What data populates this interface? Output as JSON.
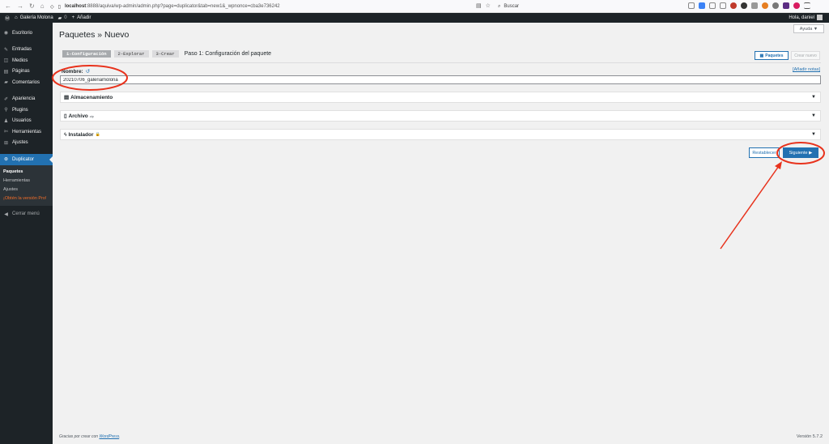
{
  "browser": {
    "url_host": "localhost",
    "url_rest": ":8888/aquiva/wp-admin/admin.php?page=duplicator&tab=new1&_wpnonce=cba3e736242",
    "search_placeholder": "Buscar"
  },
  "adminbar": {
    "site_name": "Galería Molona",
    "comments_count": "0",
    "add_label": "Añadir",
    "howdy": "Hola, daniel"
  },
  "sidebar": {
    "items": [
      {
        "label": "Escritorio",
        "icon": "dashboard-icon"
      },
      {
        "label": "Entradas",
        "icon": "pin-icon"
      },
      {
        "label": "Medios",
        "icon": "media-icon"
      },
      {
        "label": "Páginas",
        "icon": "pages-icon"
      },
      {
        "label": "Comentarios",
        "icon": "comments-icon"
      },
      {
        "label": "Apariencia",
        "icon": "brush-icon"
      },
      {
        "label": "Plugins",
        "icon": "plugin-icon"
      },
      {
        "label": "Usuarios",
        "icon": "users-icon"
      },
      {
        "label": "Herramientas",
        "icon": "wrench-icon"
      },
      {
        "label": "Ajustes",
        "icon": "settings-icon"
      },
      {
        "label": "Duplicator",
        "icon": "duplicator-icon"
      }
    ],
    "submenu": [
      "Paquetes",
      "Herramientas",
      "Ajustes",
      "¡Obtén la versión Pro!"
    ],
    "collapse": "Cerrar menú"
  },
  "main": {
    "help": "Ayuda ▼",
    "title": "Paquetes » Nuevo",
    "steps": [
      "1-Configuración",
      "2-Explorar",
      "3-Crear"
    ],
    "step_title": "Paso 1: Configuración del paquete",
    "packages_btn": "Paquetes",
    "create_new_btn": "Crear nuevo",
    "name_label": "Nombre:",
    "add_notes": "[Añadir notas]",
    "name_value": "20210706_galeriamolona",
    "panels": [
      "Almacenamiento",
      "Archivo",
      "Instalador"
    ],
    "archive_sup": "zip",
    "reset_btn": "Restablecer",
    "next_btn": "Siguiente ▶",
    "footer_text": "Gracias por crear con ",
    "footer_link": "WordPress",
    "version": "Versión 5.7.2"
  },
  "colors": {
    "admin_dark": "#1d2327",
    "accent": "#2271b1",
    "annotation": "#e8321c"
  }
}
